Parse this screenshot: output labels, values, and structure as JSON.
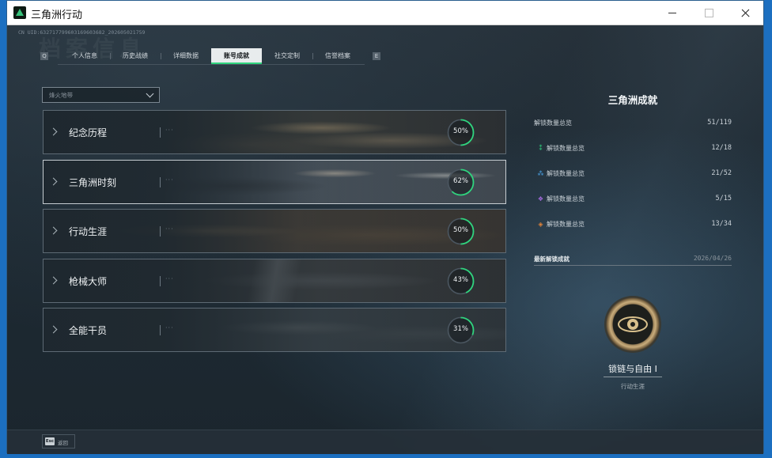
{
  "window": {
    "title": "三角洲行动"
  },
  "header": {
    "uid": "CN UID:632717799603169603682_202605021759",
    "watermark": "档案信息"
  },
  "tabs": [
    {
      "label": "个人信息",
      "active": false
    },
    {
      "label": "历史战绩",
      "active": false
    },
    {
      "label": "详细数据",
      "active": false
    },
    {
      "label": "账号成就",
      "active": true
    },
    {
      "label": "社交定制",
      "active": false
    },
    {
      "label": "信誉档案",
      "active": false
    }
  ],
  "filter": {
    "label": "烽火地带"
  },
  "achievement_cards": [
    {
      "title": "纪念历程",
      "percent": 50,
      "percent_label": "50%",
      "selected": false
    },
    {
      "title": "三角洲时刻",
      "percent": 62,
      "percent_label": "62%",
      "selected": true
    },
    {
      "title": "行动生涯",
      "percent": 50,
      "percent_label": "50%",
      "selected": false
    },
    {
      "title": "枪械大师",
      "percent": 43,
      "percent_label": "43%",
      "selected": false
    },
    {
      "title": "全能干员",
      "percent": 31,
      "percent_label": "31%",
      "selected": false
    }
  ],
  "panel": {
    "title": "三角洲成就",
    "stats": [
      {
        "label": "解锁数量总览",
        "value": "51/119",
        "icon": "none",
        "color": ""
      },
      {
        "label": "解锁数量总览",
        "value": "12/18",
        "icon": "green-rank-icon",
        "color": "#2fd47e"
      },
      {
        "label": "解锁数量总览",
        "value": "21/52",
        "icon": "blue-rank-icon",
        "color": "#4aa3e6"
      },
      {
        "label": "解锁数量总览",
        "value": "5/15",
        "icon": "purple-rank-icon",
        "color": "#a66be0"
      },
      {
        "label": "解锁数量总览",
        "value": "13/34",
        "icon": "orange-rank-icon",
        "color": "#e0833a"
      }
    ],
    "latest": {
      "label": "最新解锁成就",
      "date": "2026/04/26",
      "medal_name": "锁链与自由 I",
      "medal_category": "行动生涯"
    }
  },
  "footer": {
    "esc_key": "Esc",
    "esc_label": "返回"
  },
  "colors": {
    "accent": "#2fd47e",
    "ring_track": "#4b5660"
  }
}
